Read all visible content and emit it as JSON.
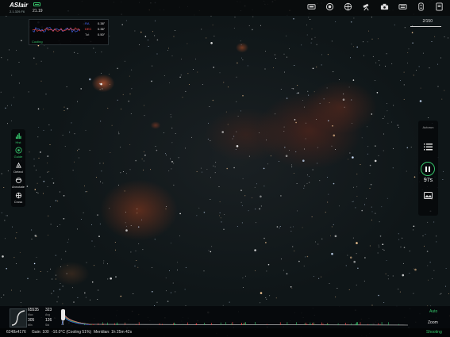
{
  "app": {
    "logo": "ASIair",
    "version": "2.1.329.F6",
    "temperature": "21.19",
    "battery_color": "#35c46a"
  },
  "top_icons": [
    "wifi-icon",
    "target-icon",
    "mount-icon",
    "telescope-icon",
    "camera-icon",
    "focuser-icon",
    "filter-wheel-icon",
    "settings-icon"
  ],
  "guide": {
    "ra_label": "RA",
    "ra_value": "0.38\"",
    "dec_label": "DEC",
    "dec_value": "0.36\"",
    "tot_label": "Tot",
    "tot_value": "0.50\"",
    "status": "Cooling"
  },
  "counter": "2/150",
  "left_toolbar": [
    {
      "id": "hist",
      "label": "Hist",
      "icon": "histogram-icon",
      "active": true
    },
    {
      "id": "guide",
      "label": "Guide",
      "icon": "guide-icon",
      "active": true
    },
    {
      "id": "detect",
      "label": "Detect",
      "icon": "detect-icon",
      "active": false
    },
    {
      "id": "annotate",
      "label": "Annotate",
      "icon": "annotate-icon",
      "active": false
    },
    {
      "id": "cross",
      "label": "Cross",
      "icon": "crosshair-icon",
      "active": false
    }
  ],
  "right_toolbar": {
    "autorun": "Autorun",
    "exposure_time": "97s"
  },
  "histogram": {
    "max_value": "65535",
    "max_label": "Max",
    "avg_value": "323",
    "avg_label": "Avg",
    "min_value": "305",
    "min_label": "Min",
    "std_value": "126",
    "std_label": "Std",
    "auto_label": "Auto",
    "zoom_label": "Zoom"
  },
  "status": {
    "resolution": "6248x4176",
    "gain": "Gain: 100",
    "cooling": "-10.0°C (Cooling 51%)",
    "meridian": "Meridian: 1h 25m 42s",
    "state": "Shooting"
  },
  "colors": {
    "accent": "#35c46a",
    "ra": "#4a6cff",
    "dec": "#ff4a4a"
  }
}
